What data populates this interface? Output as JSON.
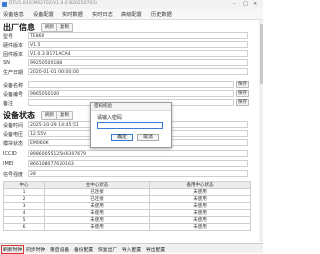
{
  "window": {
    "title": "DTU1.03(CM02702/V1.0.0 B20250703)"
  },
  "menu": [
    "设备信息",
    "设备配置",
    "实时数据",
    "实时日志",
    "高级配置",
    "历史数据"
  ],
  "factory": {
    "title": "出厂信息",
    "buttons": [
      "刷新",
      "复制"
    ],
    "rows": [
      {
        "label": "型号",
        "value": "TE860"
      },
      {
        "label": "硬件版本",
        "value": "V1.5"
      },
      {
        "label": "固件版本",
        "value": "V1.0.3 B171ACA4"
      },
      {
        "label": "SN",
        "value": "99250500188"
      },
      {
        "label": "生产日期",
        "value": "2020-01-01 00:00:00"
      }
    ]
  },
  "device_rows": [
    {
      "label": "设备名称",
      "value": "",
      "save": "保存"
    },
    {
      "label": "设备编号",
      "value": "9965050100",
      "save": "保存"
    },
    {
      "label": "备注",
      "value": "",
      "save": "保存"
    }
  ],
  "status": {
    "title": "设备状态",
    "buttons": [
      "刷新",
      "复制"
    ],
    "rows": [
      {
        "label": "设备时间",
        "value": "2025-10-29 14:45:51"
      },
      {
        "label": "设备电压",
        "value": "12.55V"
      },
      {
        "label": "模块状态",
        "value": "EM060K"
      },
      {
        "label": "ICCID",
        "value": "89860055125H0307679"
      },
      {
        "label": "IMEI",
        "value": "866108077620163"
      },
      {
        "label": "信号强度",
        "value": "28"
      }
    ]
  },
  "center_table": {
    "headers": [
      "中心",
      "主中心状态",
      "备用中心状态"
    ],
    "rows": [
      [
        "1",
        "已连接",
        "未使用"
      ],
      [
        "2",
        "已连接",
        "未使用"
      ],
      [
        "3",
        "未使用",
        "未使用"
      ],
      [
        "4",
        "未使用",
        "未使用"
      ],
      [
        "5",
        "未使用",
        "未使用"
      ],
      [
        "6",
        "未使用",
        "未使用"
      ]
    ]
  },
  "bottom_buttons": [
    "刷新时钟",
    "同步时钟",
    "重启设备",
    "备份配置",
    "恢复出厂",
    "导入配置",
    "导出配置"
  ],
  "dialog": {
    "title": "密码校验",
    "prompt": "请输入密码",
    "password_value": "",
    "ok_label": "确定",
    "cancel_label": "取消"
  }
}
